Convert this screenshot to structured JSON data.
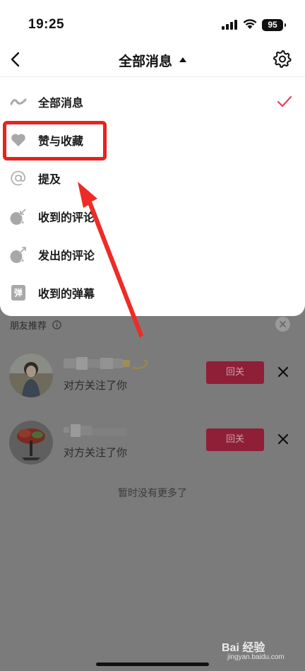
{
  "status_bar": {
    "time": "19:25",
    "battery": "95"
  },
  "header": {
    "title": "全部消息"
  },
  "menu": {
    "items": [
      {
        "label": "全部消息",
        "icon": "wave-icon",
        "selected": true
      },
      {
        "label": "赞与收藏",
        "icon": "heart-icon",
        "selected": false
      },
      {
        "label": "提及",
        "icon": "at-icon",
        "selected": false
      },
      {
        "label": "收到的评论",
        "icon": "comment-received-icon",
        "selected": false
      },
      {
        "label": "发出的评论",
        "icon": "comment-sent-icon",
        "selected": false
      },
      {
        "label": "收到的弹幕",
        "icon": "danmaku-icon",
        "icon_text": "弹",
        "selected": false
      }
    ]
  },
  "friends": {
    "section_title": "朋友推荐",
    "rows": [
      {
        "subtitle": "对方关注了你",
        "button": "回关"
      },
      {
        "subtitle": "对方关注了你",
        "button": "回关"
      }
    ],
    "footer": "暂时没有更多了"
  },
  "watermark": {
    "brand": "Bai 经验",
    "url": "jingyan.baidu.com"
  },
  "colors": {
    "accent": "#e83e5b",
    "highlight": "#e8221f",
    "dim": "#7b7b7b"
  }
}
